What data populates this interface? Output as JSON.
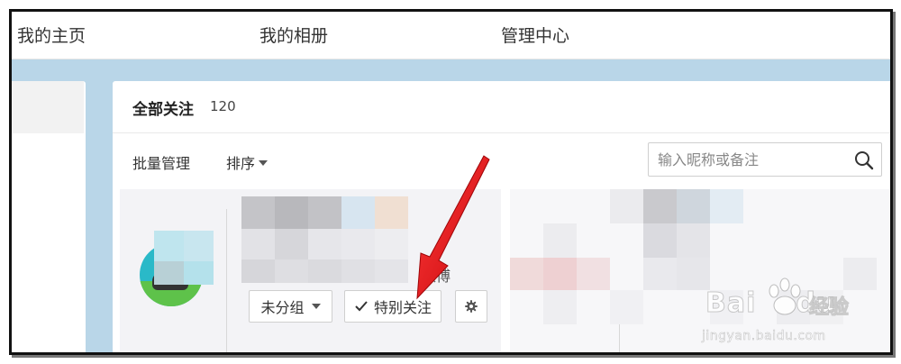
{
  "topnav": {
    "items": [
      {
        "label": "我的主页"
      },
      {
        "label": "我的相册"
      },
      {
        "label": "管理中心"
      }
    ]
  },
  "follow": {
    "title": "全部关注",
    "count": "120"
  },
  "toolbar": {
    "batch_label": "批量管理",
    "sort_label": "排序"
  },
  "search": {
    "placeholder": "输入昵称或备注"
  },
  "card": {
    "source_suffix": "微博",
    "group_label": "未分组",
    "special_label": "特别关注"
  },
  "watermark": {
    "brand": "Bai",
    "brand_suffix": "du",
    "brand_cn": "经验",
    "url": "jingyan.baidu.com"
  },
  "icons": {
    "search": "search-icon",
    "check": "check-icon",
    "settings": "gear-icon",
    "dropdown": "caret-down-icon"
  },
  "colors": {
    "background_band": "#b9d6e8",
    "arrow": "#e8141a",
    "avatar": "#2ab9c8"
  }
}
